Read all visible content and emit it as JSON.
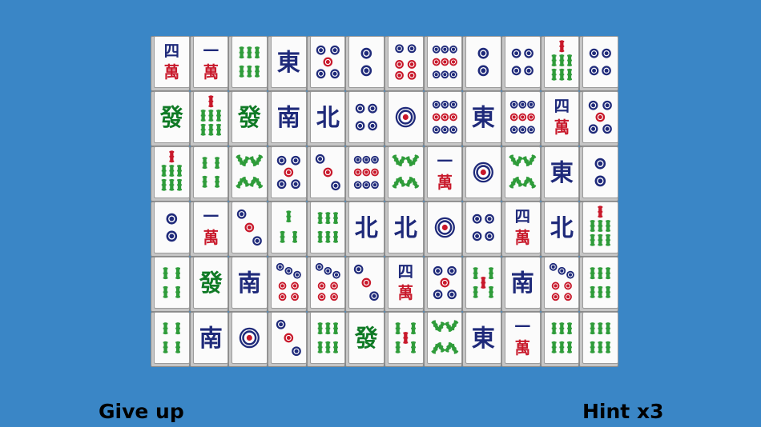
{
  "board": {
    "tiles": [
      [
        "4wan",
        "1wan",
        "6bam",
        "east",
        "5dot",
        "2dot",
        "6dot",
        "9dot",
        "2dot",
        "4dot",
        "7bam",
        "4dot"
      ],
      [
        "green",
        "7bam",
        "green",
        "south",
        "north",
        "4dot",
        "1dot",
        "9dot",
        "east",
        "9dot",
        "4wan",
        "5dot"
      ],
      [
        "7bam",
        "4bam",
        "8bam",
        "5dot",
        "3dot",
        "9dot",
        "8bam",
        "1wan",
        "1dot",
        "8bam",
        "east",
        "2dot"
      ],
      [
        "2dot",
        "1wan",
        "3dot",
        "3bam",
        "6bam",
        "north",
        "north",
        "1dot",
        "4dot",
        "4wan",
        "north",
        "7bam"
      ],
      [
        "4bam",
        "green",
        "south",
        "7dot",
        "7dot",
        "3dot",
        "4wan",
        "5dot",
        "5bam",
        "south",
        "7dot",
        "6bam"
      ],
      [
        "4bam",
        "south",
        "1dot",
        "3dot",
        "6bam",
        "green",
        "5bam",
        "8bam",
        "east",
        "1wan",
        "6bam",
        "6bam"
      ]
    ],
    "glyphs": {
      "east": "東",
      "south": "南",
      "north": "北",
      "green": "發",
      "wan": "萬",
      "wan_numbers": {
        "1": "一",
        "4": "四"
      }
    },
    "colors": {
      "blue": "#1f2a7a",
      "red": "#c8182a",
      "green": "#0f7a25",
      "bamboo": "#2f9c3a"
    }
  },
  "controls": {
    "give_up": "Give up",
    "hint": "Hint x3"
  }
}
